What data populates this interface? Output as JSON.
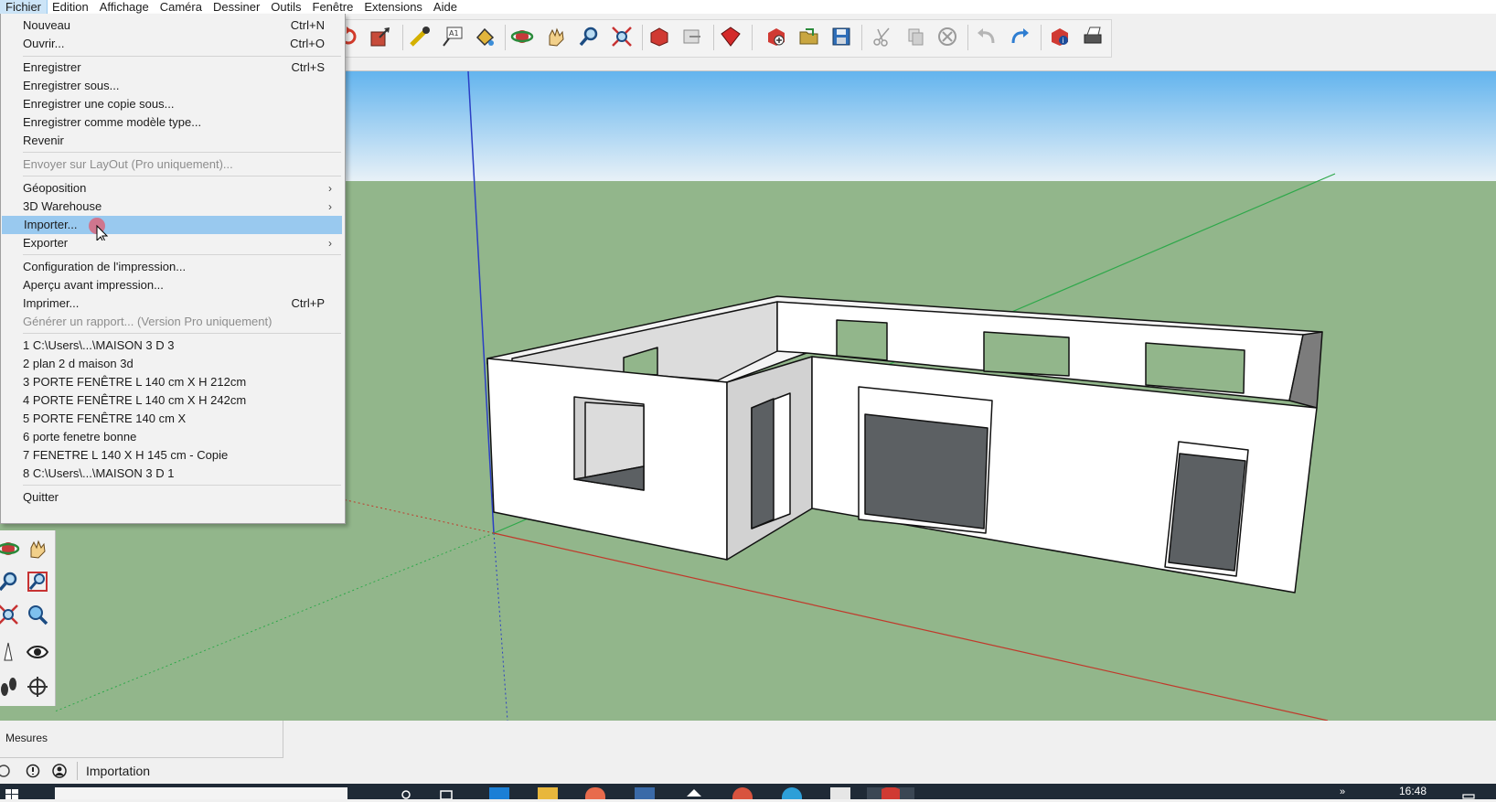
{
  "menubar": {
    "items": [
      "Fichier",
      "Edition",
      "Affichage",
      "Caméra",
      "Dessiner",
      "Outils",
      "Fenêtre",
      "Extensions",
      "Aide"
    ],
    "active_index": 0
  },
  "file_menu": {
    "items": [
      {
        "label": "Nouveau",
        "shortcut": "Ctrl+N"
      },
      {
        "label": "Ouvrir...",
        "shortcut": "Ctrl+O"
      },
      {
        "label": "Enregistrer",
        "shortcut": "Ctrl+S"
      },
      {
        "label": "Enregistrer sous..."
      },
      {
        "label": "Enregistrer une copie sous..."
      },
      {
        "label": "Enregistrer comme modèle type..."
      },
      {
        "label": "Revenir"
      },
      {
        "label": "Envoyer sur LayOut (Pro uniquement)...",
        "disabled": true
      },
      {
        "label": "Géoposition",
        "submenu": true
      },
      {
        "label": "3D Warehouse",
        "submenu": true
      },
      {
        "label": "Importer...",
        "highlighted": true
      },
      {
        "label": "Exporter",
        "submenu": true
      },
      {
        "label": "Configuration de l'impression..."
      },
      {
        "label": "Aperçu avant impression..."
      },
      {
        "label": "Imprimer...",
        "shortcut": "Ctrl+P"
      },
      {
        "label": "Générer un rapport... (Version Pro uniquement)",
        "disabled": true
      },
      {
        "label": "1 C:\\Users\\...\\MAISON 3 D 3"
      },
      {
        "label": "2 plan 2 d maison 3d"
      },
      {
        "label": "3 PORTE FENÊTRE L 140 cm X  H 212cm"
      },
      {
        "label": "4 PORTE FENÊTRE L 140 cm X  H 242cm"
      },
      {
        "label": "5 PORTE FENÊTRE 140 cm X"
      },
      {
        "label": "6 porte fenetre bonne"
      },
      {
        "label": "7 FENETRE L 140 X H 145 cm - Copie"
      },
      {
        "label": "8 C:\\Users\\...\\MAISON 3 D 1"
      },
      {
        "label": "Quitter"
      }
    ]
  },
  "measures": {
    "label": "Mesures"
  },
  "statusbar": {
    "text": "Importation"
  },
  "taskbar": {
    "clock": "16:48"
  },
  "colors": {
    "sky_top": "#63b4ee",
    "sky_bottom": "#e8f1f7",
    "ground": "#92b68b",
    "menu_highlight": "#99c9ef",
    "axis_red": "#c0392b",
    "axis_green": "#2ea84a",
    "axis_blue": "#2b3fc4"
  },
  "toolbar_icons": [
    "rotate-icon",
    "scale-icon",
    "tape-measure-icon",
    "text-icon",
    "paint-bucket-icon",
    "orbit-icon",
    "pan-icon",
    "zoom-icon",
    "zoom-extents-icon",
    "3d-warehouse-icon",
    "share-model-icon",
    "extension-warehouse-icon",
    "add-location-icon",
    "open-icon",
    "save-icon",
    "cut-icon",
    "copy-icon",
    "erase-icon",
    "undo-icon",
    "redo-icon",
    "model-info-icon",
    "print-icon"
  ]
}
